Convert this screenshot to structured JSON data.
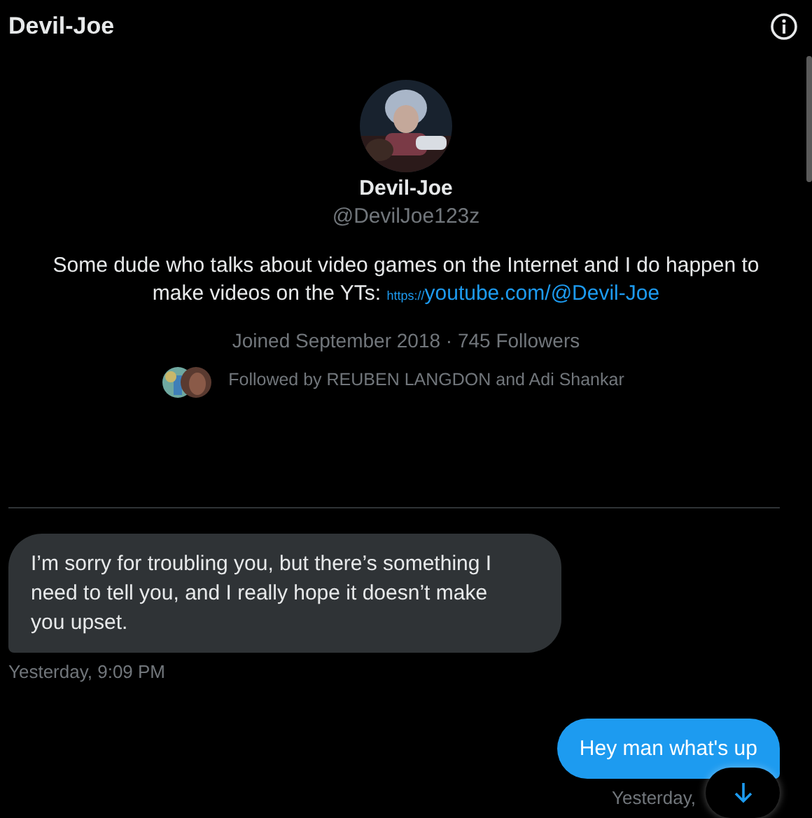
{
  "header": {
    "title": "Devil-Joe"
  },
  "profile": {
    "name": "Devil-Joe",
    "handle": "@DevilJoe123z",
    "bio": "Some dude who talks about video games on the Internet and I do happen to make videos on the YTs: ",
    "link_prefix": "https://",
    "link": "youtube.com/@Devil-Joe",
    "meta": "Joined September 2018 · 745 Followers",
    "followed_by": "Followed by REUBEN LANGDON and Adi Shankar"
  },
  "messages": [
    {
      "kind": "received",
      "text": "I’m sorry for troubling you, but there’s something I need to tell you, and I really hope it doesn’t make you upset.",
      "time": "Yesterday, 9:09 PM"
    },
    {
      "kind": "sent",
      "text": "Hey man what's up",
      "time": "Yesterday,"
    }
  ]
}
